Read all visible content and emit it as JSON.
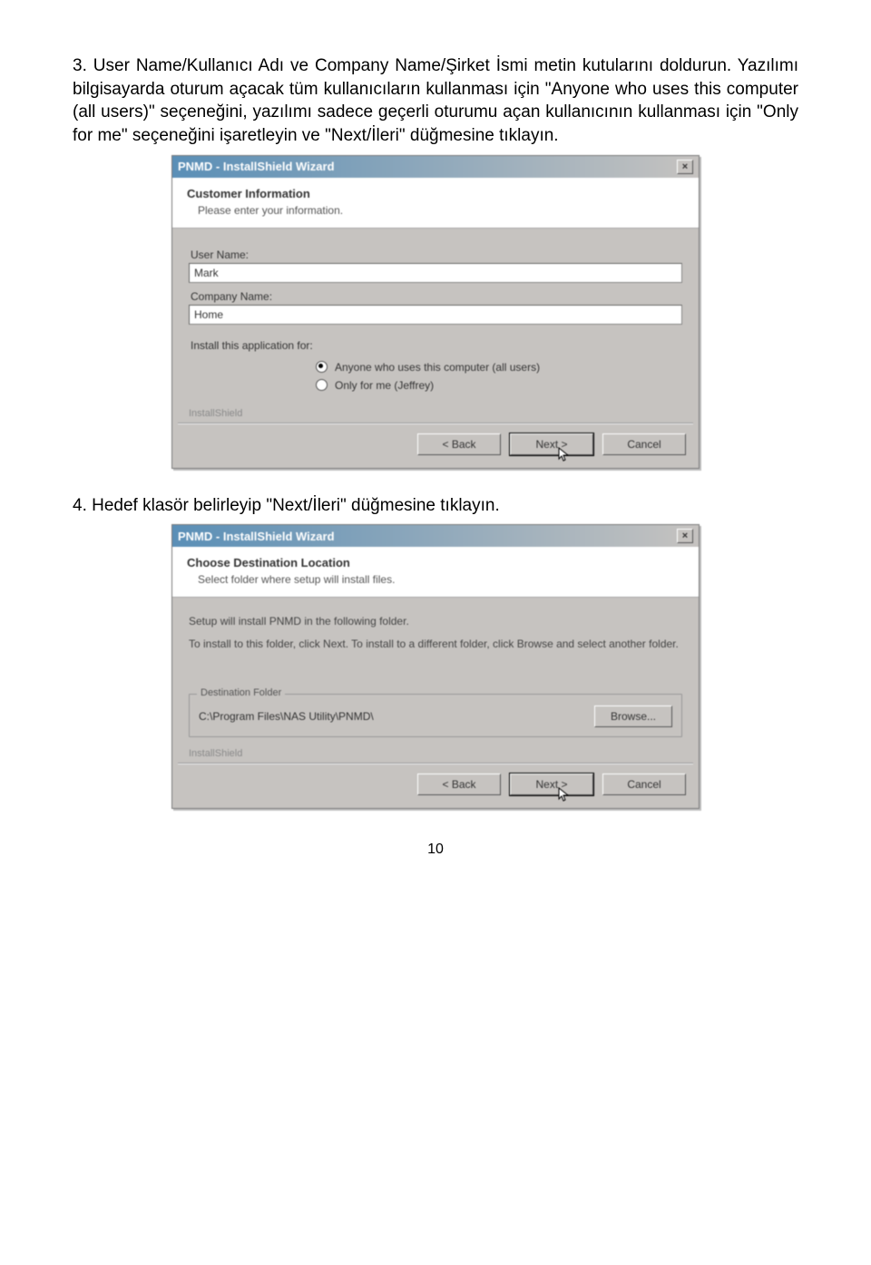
{
  "paragraph1": "3. User Name/Kullanıcı Adı ve Company Name/Şirket İsmi metin kutularını doldurun. Yazılımı bilgisayarda oturum açacak tüm kullanıcıların kullanması için \"Anyone who uses this computer (all users)\" seçeneğini, yazılımı sadece geçerli oturumu açan kullanıcının kullanması için \"Only for me\" seçeneğini işaretleyin ve \"Next/İleri\" düğmesine tıklayın.",
  "paragraph2": "4. Hedef klasör belirleyip \"Next/İleri\" düğmesine tıklayın.",
  "page_number": "10",
  "dialog1": {
    "title": "PNMD - InstallShield Wizard",
    "head_title": "Customer Information",
    "head_sub": "Please enter your information.",
    "user_label": "User Name:",
    "user_value": "Mark",
    "company_label": "Company Name:",
    "company_value": "Home",
    "install_for_label": "Install this application for:",
    "radio_all": "Anyone who uses this computer (all users)",
    "radio_me": "Only for me (Jeffrey)",
    "brand": "InstallShield",
    "btn_back": "< Back",
    "btn_next": "Next >",
    "btn_cancel": "Cancel"
  },
  "dialog2": {
    "title": "PNMD - InstallShield Wizard",
    "head_title": "Choose Destination Location",
    "head_sub": "Select folder where setup will install files.",
    "line1": "Setup will install PNMD in the following folder.",
    "line2": "To install to this folder, click Next. To install to a different folder, click Browse and select another folder.",
    "dest_legend": "Destination Folder",
    "dest_path": "C:\\Program Files\\NAS Utility\\PNMD\\",
    "btn_browse": "Browse...",
    "brand": "InstallShield",
    "btn_back": "< Back",
    "btn_next": "Next >",
    "btn_cancel": "Cancel"
  }
}
